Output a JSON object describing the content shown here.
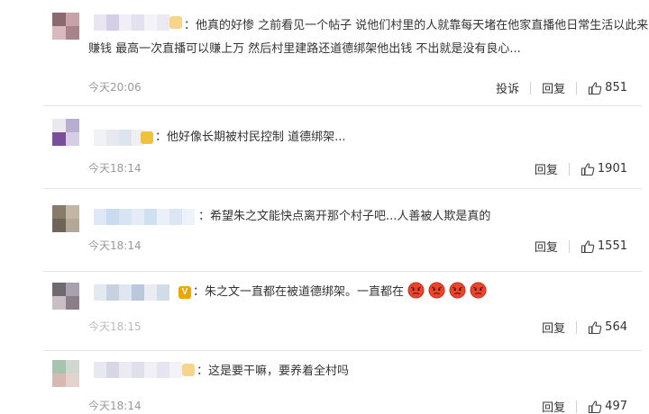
{
  "comments": [
    {
      "text_line1": "他真的好惨 之前看见一个帖子 说他们村里的人就靠每天堵在他家直播他日常生活以此来",
      "text_line2": "赚钱 最高一次直播可以赚上万 然后村里建路还道德绑架他出钱 不出就是没有良心...",
      "time": "今天20:06",
      "report": "投诉",
      "reply": "回复",
      "likes": "851"
    },
    {
      "text": "他好像长期被村民控制 道德绑架...",
      "time": "今天18:14",
      "reply": "回复",
      "likes": "1901"
    },
    {
      "text": "希望朱之文能快点离开那个村子吧...人善被人欺是真的",
      "time": "今天18:14",
      "reply": "回复",
      "likes": "1551"
    },
    {
      "text": "朱之文一直都在被道德绑架。一直都在",
      "emoji_icons": [
        "angry-face-icon",
        "angry-face-icon",
        "angry-face-icon",
        "angry-face-icon"
      ],
      "time": "今天18:15",
      "reply": "回复",
      "likes": "564"
    },
    {
      "text": "这是要干嘛，要养着全村吗",
      "time": "今天18:14",
      "reply": "回复",
      "likes": "497"
    }
  ],
  "colors": {
    "text": "#333333",
    "time": "#999999",
    "vip_gold": "#f0b400",
    "separator": "#e6e6e6",
    "emoji_red": "#e8452c"
  }
}
